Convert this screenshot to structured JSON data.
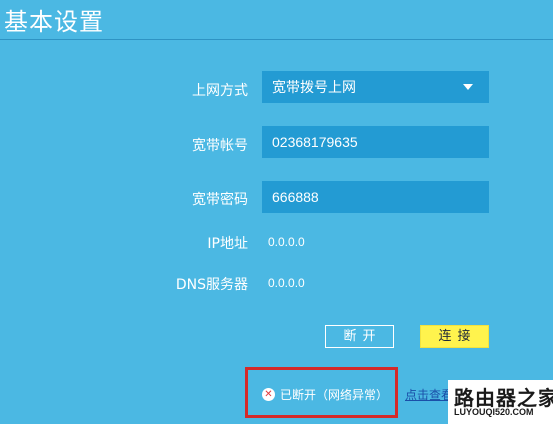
{
  "page": {
    "title": "基本设置"
  },
  "form": {
    "connection_type": {
      "label": "上网方式",
      "value": "宽带拨号上网"
    },
    "account": {
      "label": "宽带帐号",
      "value": "02368179635"
    },
    "password": {
      "label": "宽带密码",
      "value": "666888"
    },
    "ip": {
      "label": "IP地址",
      "value": "0.0.0.0"
    },
    "dns": {
      "label": "DNS服务器",
      "value": "0.0.0.0"
    }
  },
  "buttons": {
    "disconnect": "断开",
    "connect": "连接"
  },
  "status": {
    "text": "已断开（网络异常）",
    "link": "点击查看"
  },
  "watermark": {
    "main": "路由器之家",
    "sub": "LUYOUQI520.COM"
  },
  "colors": {
    "background": "#4bb8e3",
    "field": "#239bd3",
    "connect_button": "#fff34d",
    "highlight_box": "#d42a2a"
  }
}
